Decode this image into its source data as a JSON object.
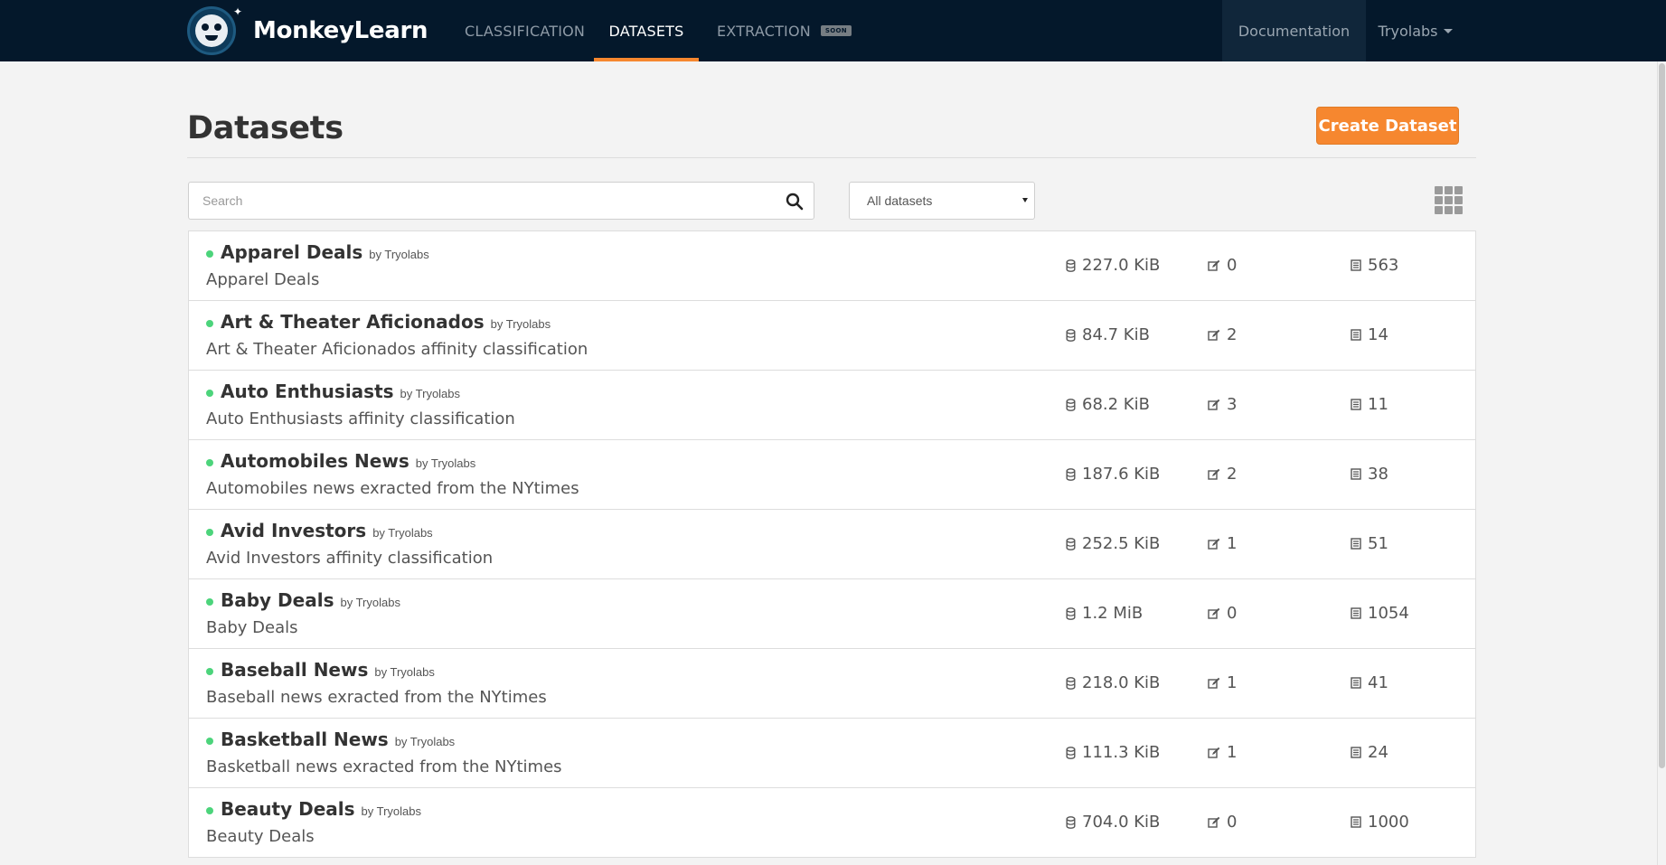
{
  "brand": {
    "name": "MonkeyLearn",
    "accent": "#f6872f",
    "nav_bg": "#04182b"
  },
  "nav": {
    "links": [
      {
        "label": "CLASSIFICATION",
        "active": false
      },
      {
        "label": "DATASETS",
        "active": true
      },
      {
        "label": "EXTRACTION",
        "active": false,
        "badge": "SOON"
      }
    ],
    "documentation": "Documentation",
    "user": "Tryolabs"
  },
  "page": {
    "title": "Datasets",
    "create_button": "Create Dataset"
  },
  "filters": {
    "search_placeholder": "Search",
    "search_value": "",
    "select_value": "All datasets"
  },
  "datasets": [
    {
      "name": "Apparel Deals",
      "by": "by Tryolabs",
      "description": "Apparel Deals",
      "size": "227.0 KiB",
      "categories": "0",
      "samples": "563"
    },
    {
      "name": "Art & Theater Aficionados",
      "by": "by Tryolabs",
      "description": "Art & Theater Aficionados affinity classification",
      "size": "84.7 KiB",
      "categories": "2",
      "samples": "14"
    },
    {
      "name": "Auto Enthusiasts",
      "by": "by Tryolabs",
      "description": "Auto Enthusiasts affinity classification",
      "size": "68.2 KiB",
      "categories": "3",
      "samples": "11"
    },
    {
      "name": "Automobiles News",
      "by": "by Tryolabs",
      "description": "Automobiles news exracted from the NYtimes",
      "size": "187.6 KiB",
      "categories": "2",
      "samples": "38"
    },
    {
      "name": "Avid Investors",
      "by": "by Tryolabs",
      "description": "Avid Investors affinity classification",
      "size": "252.5 KiB",
      "categories": "1",
      "samples": "51"
    },
    {
      "name": "Baby Deals",
      "by": "by Tryolabs",
      "description": "Baby Deals",
      "size": "1.2 MiB",
      "categories": "0",
      "samples": "1054"
    },
    {
      "name": "Baseball News",
      "by": "by Tryolabs",
      "description": "Baseball news exracted from the NYtimes",
      "size": "218.0 KiB",
      "categories": "1",
      "samples": "41"
    },
    {
      "name": "Basketball News",
      "by": "by Tryolabs",
      "description": "Basketball news exracted from the NYtimes",
      "size": "111.3 KiB",
      "categories": "1",
      "samples": "24"
    },
    {
      "name": "Beauty Deals",
      "by": "by Tryolabs",
      "description": "Beauty Deals",
      "size": "704.0 KiB",
      "categories": "0",
      "samples": "1000"
    }
  ],
  "icons": {
    "size": "database-icon",
    "categories": "edit-icon",
    "samples": "list-icon",
    "search": "search-icon",
    "view_toggle": "grid-icon"
  },
  "colors": {
    "status_active": "#4cd47b"
  }
}
